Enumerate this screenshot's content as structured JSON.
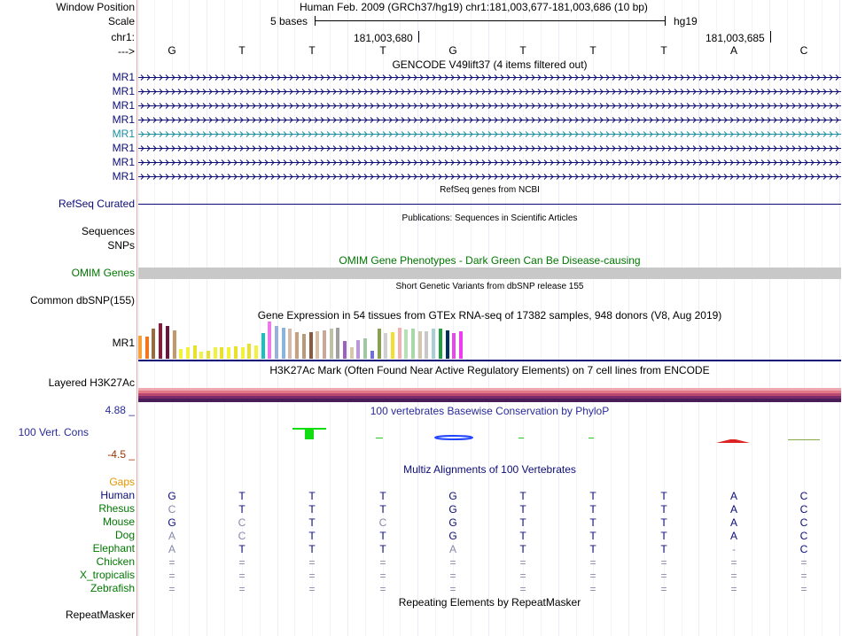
{
  "header": {
    "window_position_label": "Window Position",
    "window_position_value": "Human Feb. 2009 (GRCh37/hg19)   chr1:181,003,677-181,003,686 (10 bp)",
    "scale_label": "Scale",
    "scale_value": "5 bases",
    "assembly": "hg19",
    "chrom_label": "chr1:",
    "coord_1": "181,003,680",
    "coord_2": "181,003,685",
    "strand_label": "--->"
  },
  "sequence": [
    "G",
    "T",
    "T",
    "T",
    "G",
    "T",
    "T",
    "T",
    "A",
    "C"
  ],
  "gencode": {
    "title": "GENCODE V49lift37 (4 items filtered out)",
    "tracks": [
      {
        "label": "MR1",
        "highlight": false
      },
      {
        "label": "MR1",
        "highlight": false
      },
      {
        "label": "MR1",
        "highlight": false
      },
      {
        "label": "MR1",
        "highlight": false
      },
      {
        "label": "MR1",
        "highlight": true
      },
      {
        "label": "MR1",
        "highlight": false
      },
      {
        "label": "MR1",
        "highlight": false
      },
      {
        "label": "MR1",
        "highlight": false
      }
    ]
  },
  "refseq": {
    "title": "RefSeq genes from NCBI",
    "label": "RefSeq Curated"
  },
  "publications": {
    "title": "Publications: Sequences in Scientific Articles",
    "label": "Sequences"
  },
  "snps": {
    "label": "SNPs"
  },
  "omim": {
    "title": "OMIM Gene Phenotypes - Dark Green Can Be Disease-causing",
    "label": "OMIM Genes"
  },
  "dbsnp": {
    "title": "Short Genetic Variants from dbSNP release 155",
    "label": "Common dbSNP(155)"
  },
  "gtex": {
    "title": "Gene Expression in 54 tissues from GTEx RNA-seq of 17382 samples, 948 donors (V8, Aug 2019)",
    "label": "MR1",
    "bars": [
      {
        "color": "#f7a13b",
        "value": 0.62
      },
      {
        "color": "#f2751f",
        "value": 0.6
      },
      {
        "color": "#9b6a3c",
        "value": 0.82
      },
      {
        "color": "#8b1a3a",
        "value": 0.96
      },
      {
        "color": "#6a1540",
        "value": 0.88
      },
      {
        "color": "#c19a6b",
        "value": 0.75
      },
      {
        "color": "#f2f23c",
        "value": 0.26
      },
      {
        "color": "#f2f23c",
        "value": 0.3
      },
      {
        "color": "#e8e02a",
        "value": 0.36
      },
      {
        "color": "#f2f23c",
        "value": 0.2
      },
      {
        "color": "#e8e02a",
        "value": 0.22
      },
      {
        "color": "#f2f23c",
        "value": 0.3
      },
      {
        "color": "#e8e02a",
        "value": 0.32
      },
      {
        "color": "#f2f23c",
        "value": 0.3
      },
      {
        "color": "#e8e02a",
        "value": 0.34
      },
      {
        "color": "#f2f23c",
        "value": 0.32
      },
      {
        "color": "#e8e02a",
        "value": 0.4
      },
      {
        "color": "#f2f23c",
        "value": 0.36
      },
      {
        "color": "#19c0c0",
        "value": 0.7
      },
      {
        "color": "#ee77ee",
        "value": 1.0
      },
      {
        "color": "#9ab0d8",
        "value": 0.88
      },
      {
        "color": "#8ab4e0",
        "value": 0.84
      },
      {
        "color": "#d8b8a8",
        "value": 0.8
      },
      {
        "color": "#c8a080",
        "value": 0.72
      },
      {
        "color": "#b89a78",
        "value": 0.66
      },
      {
        "color": "#8b5a3c",
        "value": 0.72
      },
      {
        "color": "#d8c0a8",
        "value": 0.74
      },
      {
        "color": "#c8a898",
        "value": 0.76
      },
      {
        "color": "#c0c0a8",
        "value": 0.8
      },
      {
        "color": "#a0a0a0",
        "value": 0.84
      },
      {
        "color": "#9b60c0",
        "value": 0.48
      },
      {
        "color": "#d8c8a8",
        "value": 0.32
      },
      {
        "color": "#b898d8",
        "value": 0.5
      },
      {
        "color": "#a0c8a0",
        "value": 0.55
      },
      {
        "color": "#7070d8",
        "value": 0.22
      },
      {
        "color": "#88a050",
        "value": 0.82
      },
      {
        "color": "#d0d0d0",
        "value": 0.7
      },
      {
        "color": "#f2e030",
        "value": 0.72
      },
      {
        "color": "#f2b0b0",
        "value": 0.84
      },
      {
        "color": "#b8e0b8",
        "value": 0.78
      },
      {
        "color": "#a8d8a8",
        "value": 0.8
      },
      {
        "color": "#d0c8b0",
        "value": 0.74
      },
      {
        "color": "#c8c8c8",
        "value": 0.74
      },
      {
        "color": "#a8d0d0",
        "value": 0.82
      },
      {
        "color": "#20a040",
        "value": 0.82
      },
      {
        "color": "#003060",
        "value": 0.76
      },
      {
        "color": "#e050e0",
        "value": 0.7
      },
      {
        "color": "#f03cf0",
        "value": 0.74
      }
    ]
  },
  "h3k27ac": {
    "title": "H3K27Ac Mark (Often Found Near Active Regulatory Elements) on 7 cell lines from ENCODE",
    "label": "Layered H3K27Ac"
  },
  "conservation": {
    "title": "100 vertebrates Basewise Conservation by PhyloP",
    "label": "100 Vert. Cons",
    "ymax": "4.88 _",
    "ymin": "-4.5 _"
  },
  "multiz": {
    "title": "Multiz Alignments of 100 Vertebrates",
    "gaps_label": "Gaps",
    "species": [
      {
        "name": "Human",
        "bases": [
          "G",
          "T",
          "T",
          "T",
          "G",
          "T",
          "T",
          "T",
          "A",
          "C"
        ],
        "faded": [
          false,
          false,
          false,
          false,
          false,
          false,
          false,
          false,
          false,
          false
        ]
      },
      {
        "name": "Rhesus",
        "bases": [
          "C",
          "T",
          "T",
          "T",
          "G",
          "T",
          "T",
          "T",
          "A",
          "C"
        ],
        "faded": [
          true,
          false,
          false,
          false,
          false,
          false,
          false,
          false,
          false,
          false
        ]
      },
      {
        "name": "Mouse",
        "bases": [
          "G",
          "C",
          "T",
          "C",
          "G",
          "T",
          "T",
          "T",
          "A",
          "C"
        ],
        "faded": [
          false,
          true,
          false,
          true,
          false,
          false,
          false,
          false,
          false,
          false
        ]
      },
      {
        "name": "Dog",
        "bases": [
          "A",
          "C",
          "T",
          "T",
          "G",
          "T",
          "T",
          "T",
          "A",
          "C"
        ],
        "faded": [
          true,
          true,
          false,
          false,
          false,
          false,
          false,
          false,
          false,
          false
        ]
      },
      {
        "name": "Elephant",
        "bases": [
          "A",
          "T",
          "T",
          "T",
          "A",
          "T",
          "T",
          "T",
          "-",
          "C"
        ],
        "faded": [
          true,
          false,
          false,
          false,
          true,
          false,
          false,
          false,
          true,
          false
        ]
      },
      {
        "name": "Chicken",
        "bases": [
          "=",
          "=",
          "=",
          "=",
          "=",
          "=",
          "=",
          "=",
          "=",
          "="
        ],
        "faded": [
          true,
          true,
          true,
          true,
          true,
          true,
          true,
          true,
          true,
          true
        ]
      },
      {
        "name": "X_tropicalis",
        "bases": [
          "=",
          "=",
          "=",
          "=",
          "=",
          "=",
          "=",
          "=",
          "=",
          "="
        ],
        "faded": [
          true,
          true,
          true,
          true,
          true,
          true,
          true,
          true,
          true,
          true
        ]
      },
      {
        "name": "Zebrafish",
        "bases": [
          "=",
          "=",
          "=",
          "=",
          "=",
          "=",
          "=",
          "=",
          "=",
          "="
        ],
        "faded": [
          true,
          true,
          true,
          true,
          true,
          true,
          true,
          true,
          true,
          true
        ]
      }
    ]
  },
  "repeatmasker": {
    "title": "Repeating Elements by RepeatMasker",
    "label": "RepeatMasker"
  },
  "colors": {
    "gene_blue": "#0c0c78",
    "gene_highlight": "#1a8fa0",
    "omim_green": "#007700",
    "omim_bar": "#c8c8c8",
    "conservation_blue": "#2a2a9a",
    "cons_min_red": "#993300",
    "gaps_orange": "#e39600",
    "species_green": "#007800",
    "species_navy": "#0c0c78",
    "refseq_navy": "#0c0c78"
  }
}
